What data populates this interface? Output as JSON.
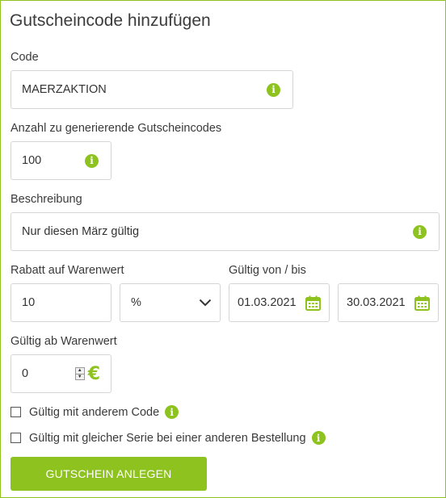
{
  "form": {
    "title": "Gutscheincode hinzufügen",
    "code": {
      "label": "Code",
      "value": "MAERZAKTION"
    },
    "count": {
      "label": "Anzahl zu generierende Gutscheincodes",
      "value": "100"
    },
    "description": {
      "label": "Beschreibung",
      "value": "Nur diesen März gültig"
    },
    "discount": {
      "label": "Rabatt auf Warenwert",
      "value": "10",
      "unit_selected": "%"
    },
    "validity": {
      "label": "Gültig von / bis",
      "from": "01.03.2021",
      "to": "30.03.2021"
    },
    "min_value": {
      "label": "Gültig ab Warenwert",
      "value": "0",
      "currency": "€"
    },
    "checkbox_other_code": {
      "label": "Gültig mit anderem Code",
      "checked": false
    },
    "checkbox_same_series": {
      "label": "Gültig mit gleicher Serie bei einer anderen Bestellung",
      "checked": false
    },
    "submit_label": "GUTSCHEIN ANLEGEN"
  },
  "icons": {
    "info": "info-icon",
    "calendar": "calendar-icon",
    "chevron": "chevron-down-icon"
  },
  "colors": {
    "accent": "#8dc21f"
  }
}
